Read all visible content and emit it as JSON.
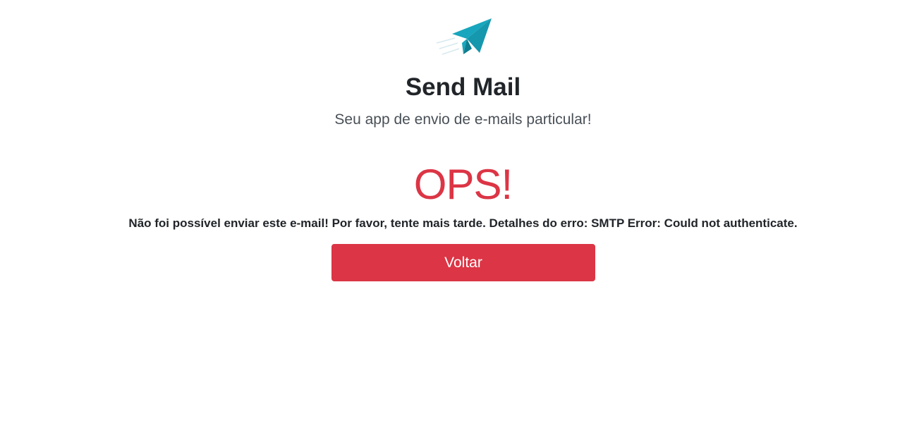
{
  "header": {
    "logo_icon": "paper-plane-icon",
    "logo_color": "#17a2b8",
    "title": "Send Mail",
    "subtitle": "Seu app de envio de e-mails particular!"
  },
  "error": {
    "heading": "OPS!",
    "heading_color": "#dc3545",
    "message": "Não foi possível enviar este e-mail! Por favor, tente mais tarde. Detalhes do erro: SMTP Error: Could not authenticate."
  },
  "actions": {
    "back_label": "Voltar",
    "back_color": "#dc3545"
  }
}
